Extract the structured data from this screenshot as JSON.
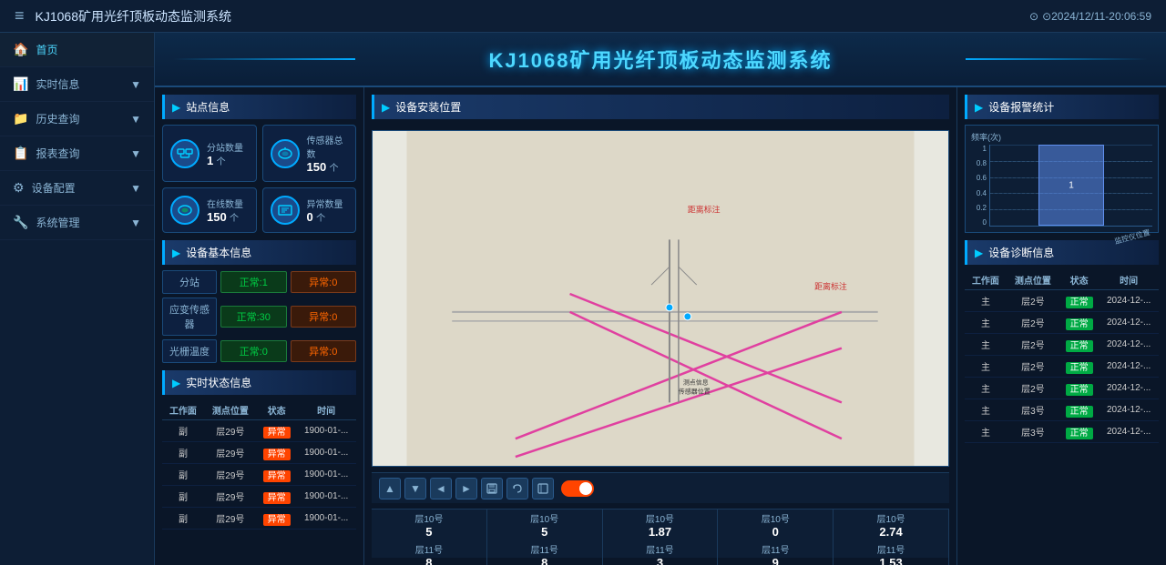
{
  "topbar": {
    "menu_icon": "≡",
    "title": "KJ1068矿用光纤顶板动态监测系统",
    "clock_icon": "⏰",
    "datetime": "⊙2024/12/11-20:06:59"
  },
  "sidebar": {
    "items": [
      {
        "id": "home",
        "icon": "🏠",
        "label": "首页",
        "active": true
      },
      {
        "id": "realtime",
        "icon": "📊",
        "label": "实时信息",
        "has_arrow": true
      },
      {
        "id": "history",
        "icon": "📁",
        "label": "历史查询",
        "has_arrow": true
      },
      {
        "id": "report",
        "icon": "📋",
        "label": "报表查询",
        "has_arrow": true
      },
      {
        "id": "device",
        "icon": "⚙",
        "label": "设备配置",
        "has_arrow": true
      },
      {
        "id": "system",
        "icon": "🔧",
        "label": "系统管理",
        "has_arrow": true
      }
    ]
  },
  "banner": {
    "title": "KJ1068矿用光纤顶板动态监测系统"
  },
  "station_info": {
    "section_title": "站点信息",
    "substations": {
      "label": "分站数量",
      "value": "1",
      "unit": "个"
    },
    "sensors_total": {
      "label": "传感器总数",
      "value": "150",
      "unit": "个"
    },
    "online": {
      "label": "在线数量",
      "value": "150",
      "unit": "个"
    },
    "abnormal": {
      "label": "异常数量",
      "value": "0",
      "unit": "个"
    }
  },
  "device_basic": {
    "section_title": "设备基本信息",
    "rows": [
      {
        "name": "分站",
        "normal_label": "正常:1",
        "abnormal_label": "异常:0"
      },
      {
        "name": "应变传感器",
        "normal_label": "正常:30",
        "abnormal_label": "异常:0"
      },
      {
        "name": "光栅温度",
        "normal_label": "正常:0",
        "abnormal_label": "异常:0"
      }
    ]
  },
  "realtime_status": {
    "section_title": "实时状态信息",
    "columns": [
      "工作面",
      "测点位置",
      "状态",
      "时间"
    ],
    "rows": [
      {
        "workface": "副",
        "point": "层29号",
        "status": "异常",
        "time": "1900-01-..."
      },
      {
        "workface": "副",
        "point": "层29号",
        "status": "异常",
        "time": "1900-01-..."
      },
      {
        "workface": "副",
        "point": "层29号",
        "status": "异常",
        "time": "1900-01-..."
      },
      {
        "workface": "副",
        "point": "层29号",
        "status": "异常",
        "time": "1900-01-..."
      },
      {
        "workface": "副",
        "point": "层29号",
        "status": "异常",
        "time": "1900-01-..."
      }
    ]
  },
  "device_location": {
    "section_title": "设备安装位置"
  },
  "toolbar": {
    "buttons": [
      "▲",
      "▼",
      "◄",
      "►",
      "💾",
      "↩",
      "▭"
    ]
  },
  "bottom_cells": [
    {
      "label": "层10号",
      "value": "5"
    },
    {
      "label": "层10号",
      "value": "5"
    },
    {
      "label": "层10号",
      "value": "1.87"
    },
    {
      "label": "层10号",
      "value": "0"
    },
    {
      "label": "层10号",
      "value": "2.74"
    },
    {
      "label": "层11号",
      "value": "8"
    },
    {
      "label": "层11号",
      "value": "8"
    },
    {
      "label": "层11号",
      "value": "3"
    },
    {
      "label": "层11号",
      "value": "9"
    },
    {
      "label": "层11号",
      "value": "1.53"
    }
  ],
  "alarm_stats": {
    "section_title": "设备报警统计",
    "y_label": "频率(次)",
    "y_values": [
      "1",
      "0.8",
      "0.6",
      "0.4",
      "0.2",
      "0"
    ],
    "bar_value": "1",
    "x_label": "监控仪位置"
  },
  "device_diagnosis": {
    "section_title": "设备诊断信息",
    "columns": [
      "工作面",
      "测点位置",
      "状态",
      "时间"
    ],
    "rows": [
      {
        "workface": "主",
        "point": "层2号",
        "status": "正常",
        "time": "2024-12-..."
      },
      {
        "workface": "主",
        "point": "层2号",
        "status": "正常",
        "time": "2024-12-..."
      },
      {
        "workface": "主",
        "point": "层2号",
        "status": "正常",
        "time": "2024-12-..."
      },
      {
        "workface": "主",
        "point": "层2号",
        "status": "正常",
        "time": "2024-12-..."
      },
      {
        "workface": "主",
        "point": "层2号",
        "status": "正常",
        "time": "2024-12-..."
      },
      {
        "workface": "主",
        "point": "层3号",
        "status": "正常",
        "time": "2024-12-..."
      },
      {
        "workface": "主",
        "point": "层3号",
        "status": "正常",
        "time": "2024-12-..."
      }
    ]
  },
  "colors": {
    "accent": "#00aaff",
    "bg_dark": "#0a1628",
    "bg_panel": "#0d1e35",
    "normal_green": "#00cc44",
    "abnormal_red": "#ff4400",
    "text_muted": "#8ab4d4"
  }
}
